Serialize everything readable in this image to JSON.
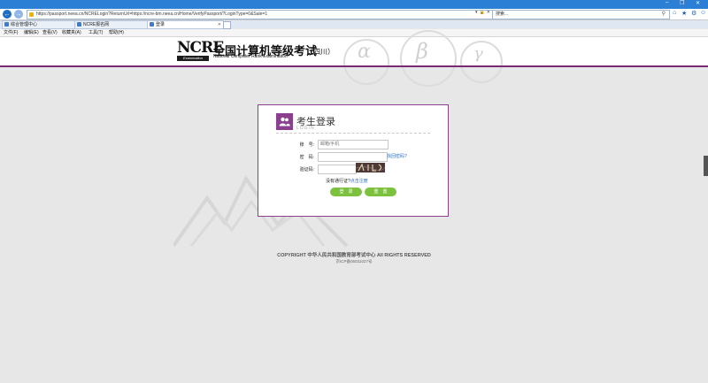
{
  "browser": {
    "url": "https://passport.neea.cn/NCRELogin?ReturnUrl=https://ncre-bm.neea.cn/Home/VerifyPassport/?LoginType=0&Sale=1",
    "search_placeholder": "搜索...",
    "tabs": [
      {
        "label": "综合管理中心"
      },
      {
        "label": "NCRE报名网"
      },
      {
        "label": "登录"
      }
    ],
    "menu": [
      {
        "label": "文件(F)"
      },
      {
        "label": "编辑(E)"
      },
      {
        "label": "查看(V)"
      },
      {
        "label": "收藏夹(A)"
      },
      {
        "label": "工具(T)"
      },
      {
        "label": "帮助(H)"
      }
    ]
  },
  "site": {
    "logo_text": "NCRE",
    "logo_sub": "Examination",
    "title": "全国计算机等级考试",
    "subtitle": "National Computer Rank Examination",
    "province": "（四川）"
  },
  "login": {
    "title": "考生登录",
    "subtitle": "LOGIN",
    "account_label": "账　号:",
    "account_placeholder": "邮箱/手机",
    "password_label": "密　码:",
    "forgot_link": "找回密码?",
    "captcha_label": "验证码:",
    "register_prompt": "没有通行证?",
    "register_link": "点击注册",
    "login_button": "登　录",
    "reset_button": "重　置"
  },
  "footer": {
    "copyright": "COPYRIGHT 中华人民共和国教育部考试中心 All RIGHTS RESERVED",
    "icp": "京ICP备05031027号"
  },
  "colors": {
    "accent": "#8b3f8f",
    "button": "#7cc23f",
    "browser_blue": "#2b7fd5"
  }
}
